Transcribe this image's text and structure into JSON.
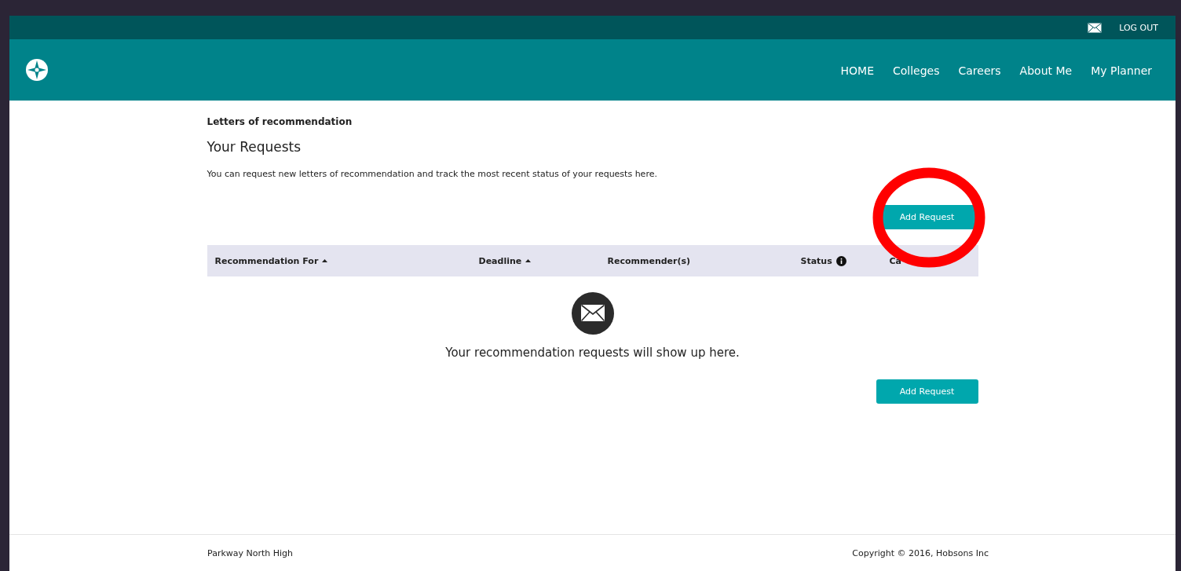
{
  "top_bar": {
    "logout": "LOG OUT"
  },
  "nav": {
    "items": [
      {
        "label": "HOME"
      },
      {
        "label": "Colleges"
      },
      {
        "label": "Careers"
      },
      {
        "label": "About Me"
      },
      {
        "label": "My Planner"
      }
    ]
  },
  "breadcrumb": "Letters of recommendation",
  "heading": "Your Requests",
  "intro": "You can request new letters of recommendation and track the most recent status of your requests here.",
  "add_button_top": "Add Request",
  "table": {
    "columns": [
      {
        "label": "Recommendation For",
        "sortable": true
      },
      {
        "label": "Deadline",
        "sortable": true
      },
      {
        "label": "Recommender(s)"
      },
      {
        "label": "Status",
        "info": true
      },
      {
        "label": "Ca"
      }
    ]
  },
  "empty_message": "Your recommendation requests will show up here.",
  "add_button_bottom": "Add Request",
  "footer": {
    "school": "Parkway North High",
    "copyright": "Copyright © 2016, Hobsons Inc"
  },
  "annotation": {
    "kind": "circle",
    "color": "#ff0000"
  }
}
